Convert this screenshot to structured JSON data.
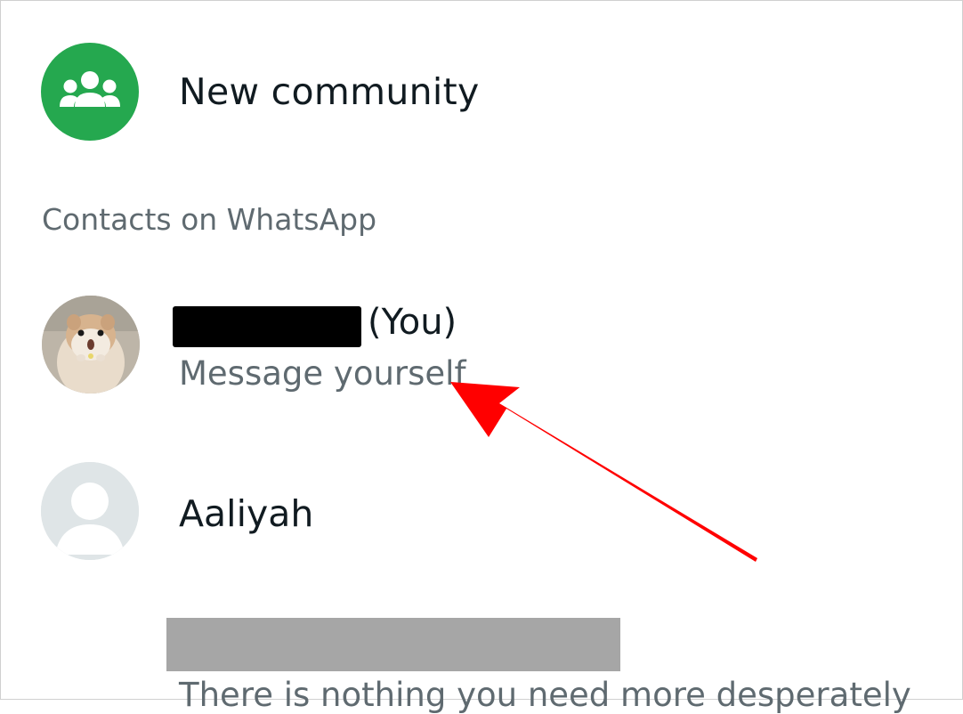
{
  "new_community": {
    "label": "New community",
    "icon": "community-icon",
    "accent_color": "#25a84f"
  },
  "section": {
    "label": "Contacts on WhatsApp"
  },
  "contacts": [
    {
      "name_suffix": "(You)",
      "subtitle": "Message yourself",
      "avatar": "hamster-photo"
    },
    {
      "name": "Aaliyah",
      "avatar": "default-avatar-icon",
      "status": "There is nothing you need more desperately"
    }
  ],
  "annotation": {
    "arrow_color": "#ff0000"
  }
}
